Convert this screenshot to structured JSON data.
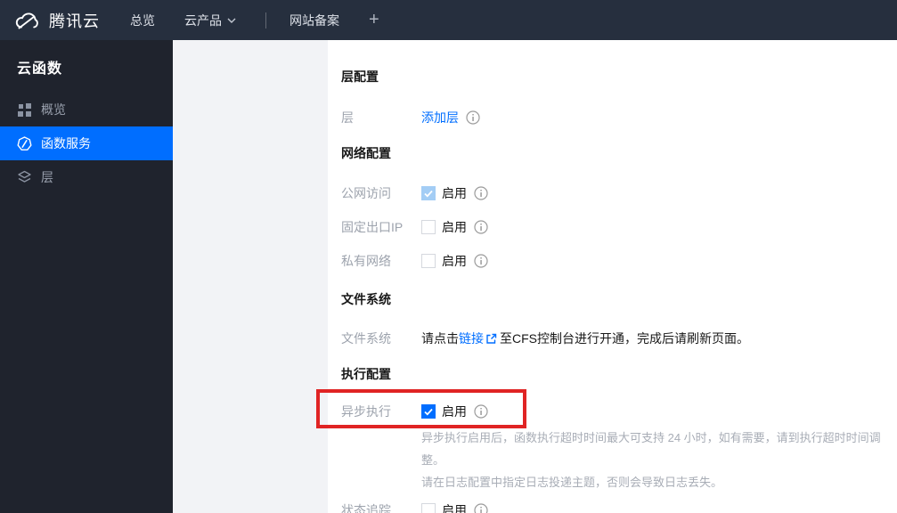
{
  "topbar": {
    "brand": "腾讯云",
    "items": {
      "overview": "总览",
      "cloud_products": "云产品",
      "website_filing": "网站备案",
      "add": "+"
    }
  },
  "sidebar": {
    "title": "云函数",
    "items": [
      {
        "label": "概览",
        "icon": "grid-icon",
        "active": false
      },
      {
        "label": "函数服务",
        "icon": "function-icon",
        "active": true
      },
      {
        "label": "层",
        "icon": "layers-icon",
        "active": false
      }
    ]
  },
  "form": {
    "sections": {
      "layer": {
        "title": "层配置"
      },
      "network": {
        "title": "网络配置"
      },
      "filesystem": {
        "title": "文件系统"
      },
      "execution": {
        "title": "执行配置"
      }
    },
    "rows": {
      "layer": {
        "label": "层",
        "action": "添加层"
      },
      "public_access": {
        "label": "公网访问",
        "toggle_label": "启用",
        "state": "checked-disabled"
      },
      "fixed_egress_ip": {
        "label": "固定出口IP",
        "toggle_label": "启用",
        "state": "unchecked"
      },
      "private_network": {
        "label": "私有网络",
        "toggle_label": "启用",
        "state": "unchecked"
      },
      "filesystem": {
        "label": "文件系统",
        "text_before": "请点击",
        "link": "链接",
        "text_after": "至CFS控制台进行开通，完成后请刷新页面。"
      },
      "async_execution": {
        "label": "异步执行",
        "toggle_label": "启用",
        "state": "checked",
        "note_line1": "异步执行启用后，函数执行超时时间最大可支持 24 小时，如有需要，请到执行超时时间调整。",
        "note_line2": "请在日志配置中指定日志投递主题，否则会导致日志丢失。"
      },
      "status_tracking": {
        "label": "状态追踪",
        "toggle_label": "启用",
        "state": "unchecked"
      }
    }
  },
  "annotation": {
    "type": "highlight-box"
  },
  "colors": {
    "accent": "#006eff",
    "topbar-bg": "#262f3e",
    "sidebar-bg": "#1f232d",
    "annotation": "#e02424",
    "checked-disabled": "#a3cdf5"
  }
}
